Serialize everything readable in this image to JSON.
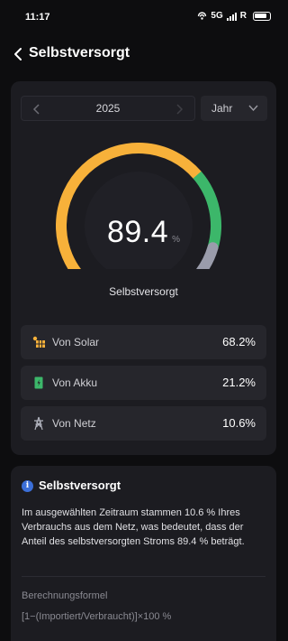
{
  "status_bar": {
    "time": "11:17",
    "network": "5G",
    "carrier_letter": "R"
  },
  "header": {
    "title": "Selbstversorgt"
  },
  "selector": {
    "year": "2025",
    "period": "Jahr"
  },
  "gauge": {
    "value": "89.4",
    "unit": "%",
    "label": "Selbstversorgt",
    "segments": [
      {
        "name": "solar",
        "fraction": 0.682,
        "color": "#f7b13a"
      },
      {
        "name": "akku",
        "fraction": 0.212,
        "color": "#3cb76a"
      },
      {
        "name": "netz",
        "fraction": 0.106,
        "color": "#9a9cab"
      }
    ]
  },
  "sources": [
    {
      "icon": "solar-panel-icon",
      "label": "Von Solar",
      "value": "68.2%",
      "color": "#f7b13a"
    },
    {
      "icon": "battery-icon",
      "label": "Von Akku",
      "value": "21.2%",
      "color": "#3cb76a"
    },
    {
      "icon": "power-tower-icon",
      "label": "Von Netz",
      "value": "10.6%",
      "color": "#9a9cab"
    }
  ],
  "info": {
    "title": "Selbstversorgt",
    "text": "Im ausgewählten Zeitraum stammen 10.6 % Ihres Verbrauchs aus dem Netz, was bedeutet, dass der Anteil des selbstversorgten Stroms 89.4 % beträgt.",
    "formula_label": "Berechnungsformel",
    "formula": "[1−(Importiert/Verbraucht)]×100 %"
  }
}
